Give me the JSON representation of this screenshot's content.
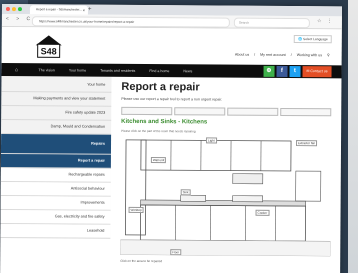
{
  "browser": {
    "tab_title": "Report a repair - Sdsmanchester...",
    "tab_close": "×",
    "new_tab": "+",
    "nav_buttons": "< > C",
    "url": "https://www.s48manchester.co.uk/your-home/repairs/report-a-repair",
    "search_placeholder": "Search",
    "tools": "☆ ⋮"
  },
  "site": {
    "logo_text": "S48",
    "select_language": "Select Language",
    "top_links": [
      "About us",
      "My rent account",
      "Working with us"
    ],
    "search_icon": "search-icon",
    "nav": {
      "home_icon": "home-icon",
      "items": [
        "The vision",
        "Your home",
        "Tenants and residents",
        "Find a home",
        "News"
      ],
      "social": [
        {
          "icon": "share-icon",
          "glyph": "⊕",
          "color": "#3fb04b"
        },
        {
          "icon": "facebook-icon",
          "glyph": "f",
          "color": "#3b5998"
        },
        {
          "icon": "twitter-icon",
          "glyph": "t",
          "color": "#1da1f2"
        }
      ],
      "contact": "✉ Contact us"
    }
  },
  "sidebar": {
    "items": [
      {
        "label": "Your home",
        "type": "top"
      },
      {
        "label": "Making payments and view your statement",
        "type": "top"
      },
      {
        "label": "Fire safety update 2023",
        "type": "top"
      },
      {
        "label": "Damp, Mould and Condensation",
        "type": "top"
      },
      {
        "label": "Repairs",
        "type": "active"
      },
      {
        "label": "Report a repair",
        "type": "current"
      },
      {
        "label": "Rechargeable repairs",
        "type": "sub"
      },
      {
        "label": "Antisocial behaviour",
        "type": "sub"
      },
      {
        "label": "Improvements",
        "type": "sub"
      },
      {
        "label": "Gas, electricity and fire safety",
        "type": "sub"
      },
      {
        "label": "Leasehold",
        "type": "sub"
      }
    ]
  },
  "content": {
    "title": "Report a repair",
    "intro": "Please use our report a repair tool to report a non urgent repair.",
    "tabs": [
      "",
      "",
      "",
      ""
    ],
    "room_heading": "Kitchens and Sinks - Kitchens",
    "hint": "Please click on the part of the room that needs repairing",
    "callouts": [
      "Extractor fan",
      "Light",
      "Cooker",
      "Worktop",
      "Sink",
      "Wall unit",
      "Floor"
    ],
    "caption": "Click on the area to be repaired"
  },
  "colors": {
    "nav_bg": "#0d0d0d",
    "sidebar_active": "#1f4e79",
    "room_heading": "#3a8c2f",
    "contact_bg": "#e34e25"
  }
}
